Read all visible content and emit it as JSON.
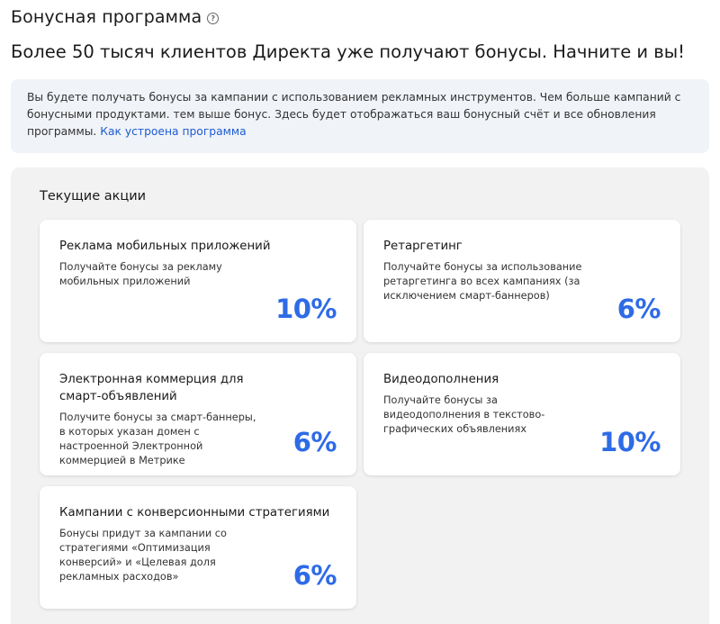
{
  "header": {
    "title": "Бонусная программа",
    "help_icon_glyph": "?",
    "subtitle": "Более 50 тысяч клиентов Директа уже получают бонусы. Начните и вы!"
  },
  "info": {
    "text": "Вы будете получать бонусы за кампании с использованием рекламных инструментов. Чем больше кампаний с бонусными продуктами. тем выше бонус. Здесь будет отображаться ваш бонусный счёт и все обновления программы.",
    "link_label": "Как устроена программа"
  },
  "promotions": {
    "heading": "Текущие акции",
    "cards": [
      {
        "title": "Реклама мобильных приложений",
        "description": "Получайте бонусы за рекламу мобильных приложений",
        "percent": "10%"
      },
      {
        "title": "Ретаргетинг",
        "description": "Получайте бонусы за использование ретаргетинга во всех кампаниях (за исключением смарт-баннеров)",
        "percent": "6%"
      },
      {
        "title": "Электронная коммерция для смарт-объявлений",
        "description": "Получите бонусы за смарт-баннеры, в которых указан домен с настроенной Электронной коммерцией в Метрике",
        "percent": "6%"
      },
      {
        "title": "Видеодополнения",
        "description": "Получайте бонусы за видеодополнения в текстово-графических объявлениях",
        "percent": "10%"
      },
      {
        "title": "Кампании с конверсионными стратегиями",
        "description": "Бонусы придут за кампании со стратегиями «Оптимизация конверсий» и «Целевая доля рекламных расходов»",
        "percent": "6%"
      }
    ]
  },
  "colors": {
    "accent": "#2e6be6",
    "link": "#1f5bd1",
    "info_bg": "#f0f3f8",
    "panel_bg": "#f2f2f2"
  }
}
